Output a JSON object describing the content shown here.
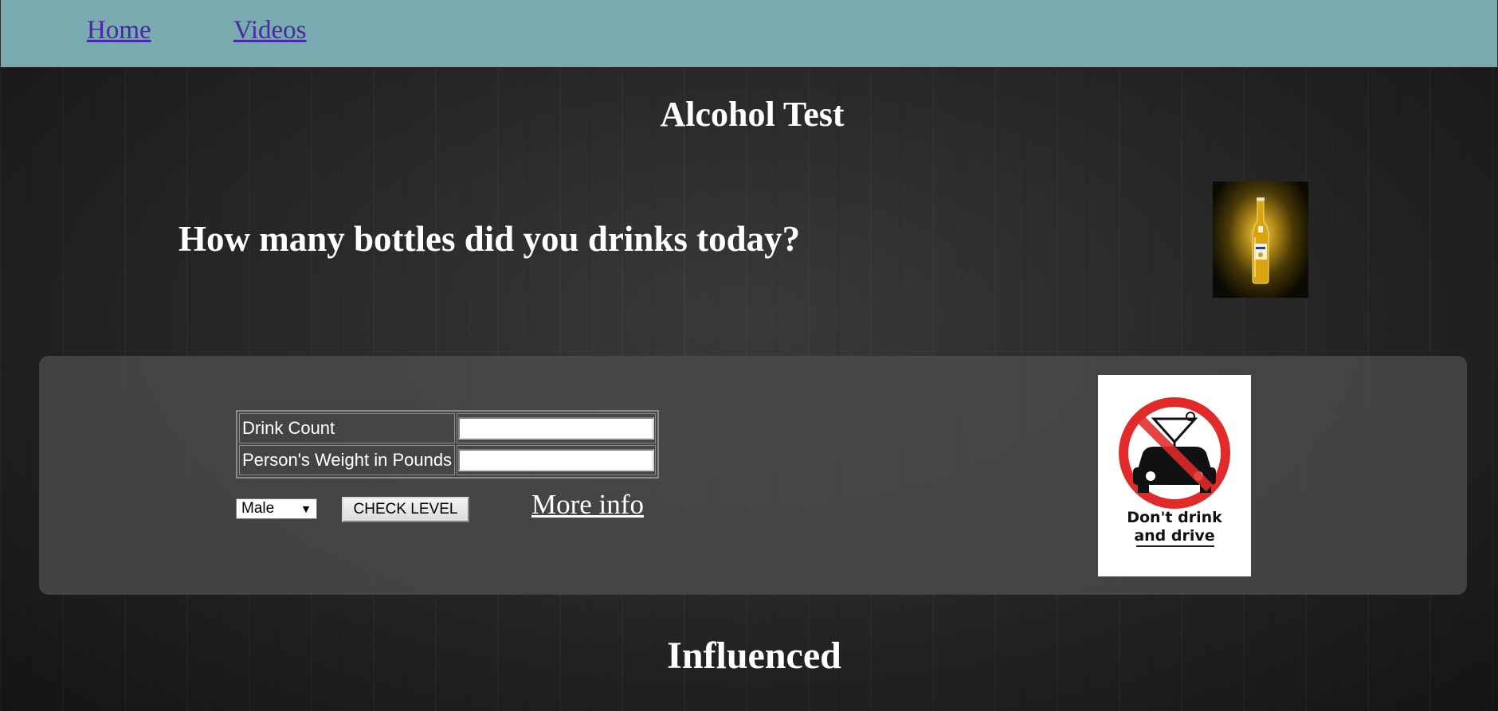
{
  "nav": {
    "home": "Home",
    "videos": "Videos"
  },
  "page": {
    "title": "Alcohol Test",
    "question": "How many bottles did you drinks today?"
  },
  "form": {
    "drink_count_label": "Drink Count",
    "drink_count_value": "",
    "weight_label": "Person's Weight in Pounds",
    "weight_value": "",
    "gender_selected": "Male",
    "check_button": "CHECK LEVEL",
    "more_info": "More info"
  },
  "sign": {
    "caption_line1": "Don't  drink",
    "caption_line2": "and drive"
  },
  "section": {
    "heading": "Influenced"
  },
  "icons": {
    "beer_bottle": "beer-bottle-image",
    "no_drink_drive": "no-drink-drive-sign"
  },
  "colors": {
    "navbar": "#78aaaf",
    "nav_link": "#4a28a8",
    "panel": "#4e4d4c",
    "prohibition_red": "#e32a2a"
  }
}
